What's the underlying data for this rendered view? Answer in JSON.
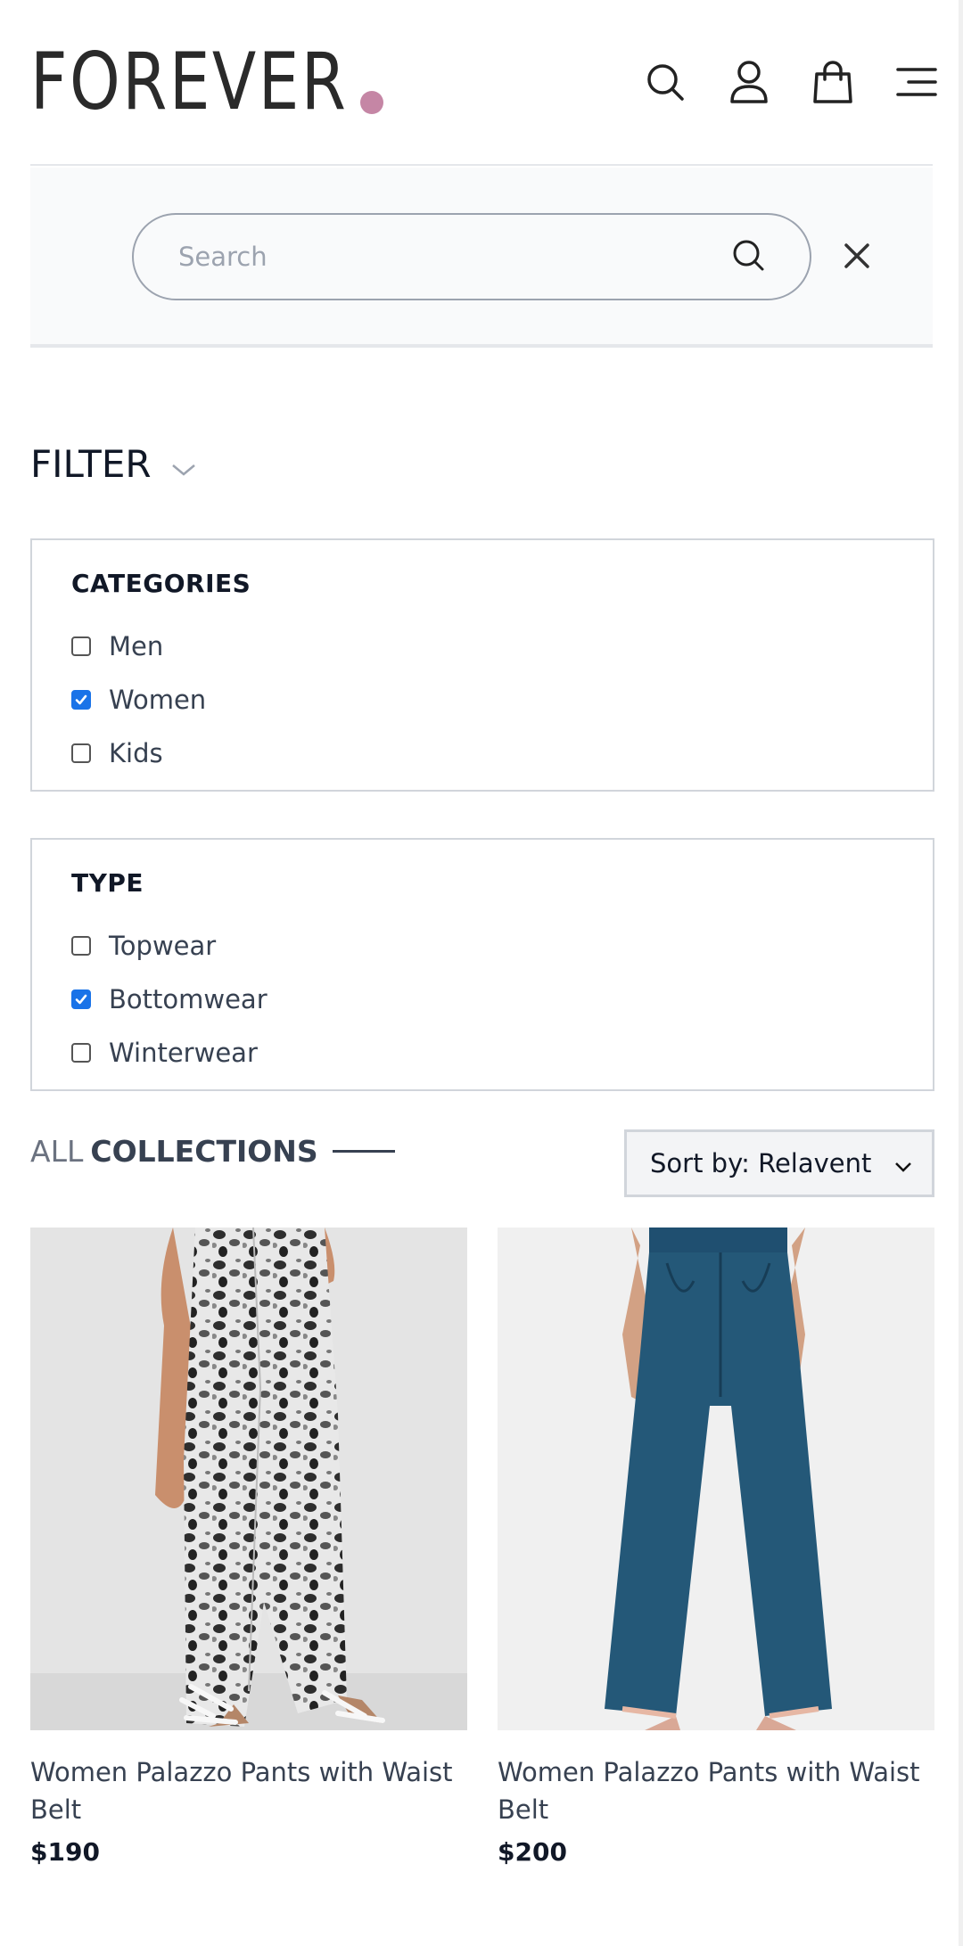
{
  "brand": {
    "name": "FOREVER",
    "accent": "#c586a5"
  },
  "header": {
    "icons": [
      "search-icon",
      "user-icon",
      "bag-icon",
      "menu-icon"
    ]
  },
  "search": {
    "placeholder": "Search",
    "value": ""
  },
  "filter": {
    "title": "FILTER",
    "categories": {
      "title": "CATEGORIES",
      "options": [
        {
          "label": "Men",
          "checked": false
        },
        {
          "label": "Women",
          "checked": true
        },
        {
          "label": "Kids",
          "checked": false
        }
      ]
    },
    "type": {
      "title": "TYPE",
      "options": [
        {
          "label": "Topwear",
          "checked": false
        },
        {
          "label": "Bottomwear",
          "checked": true
        },
        {
          "label": "Winterwear",
          "checked": false
        }
      ]
    }
  },
  "collections": {
    "prefix": "ALL",
    "title": "COLLECTIONS"
  },
  "sort": {
    "selected": "Sort by: Relavent"
  },
  "products": [
    {
      "name": "Women Palazzo Pants with Waist Belt",
      "price": "$190"
    },
    {
      "name": "Women Palazzo Pants with Waist Belt",
      "price": "$200"
    }
  ],
  "colors": {
    "checkbox_checked": "#1a73e8",
    "text_primary": "#111827",
    "text_secondary": "#374151"
  }
}
